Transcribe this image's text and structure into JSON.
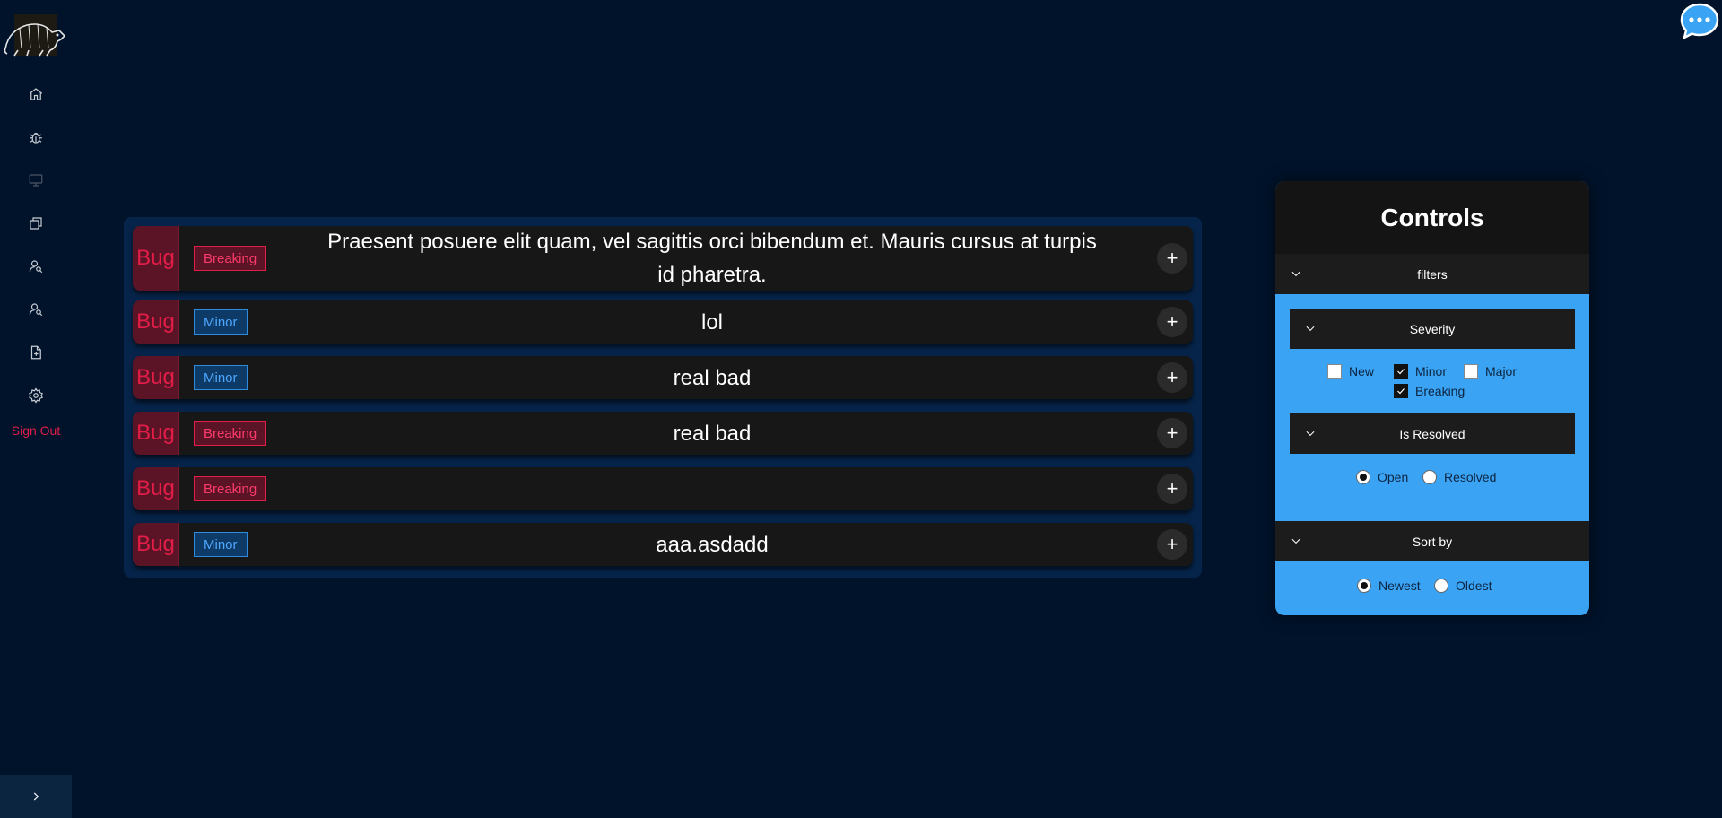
{
  "sidebar": {
    "nav": [
      {
        "icon": "home-icon"
      },
      {
        "icon": "bug-icon"
      },
      {
        "icon": "monitor-icon"
      },
      {
        "icon": "copy-icon"
      },
      {
        "icon": "user-search-icon"
      },
      {
        "icon": "user-search-icon"
      },
      {
        "icon": "file-plus-icon"
      },
      {
        "icon": "gear-icon"
      }
    ],
    "sign_out": "Sign Out",
    "expand_icon": "chevron-right-icon"
  },
  "chat_icon": "chat-bubble-icon",
  "bugs": [
    {
      "type": "Bug",
      "severity": "Breaking",
      "title": "Praesent posuere elit quam, vel sagittis orci bibendum et. Mauris cursus at turpis id pharetra."
    },
    {
      "type": "Bug",
      "severity": "Minor",
      "title": "lol"
    },
    {
      "type": "Bug",
      "severity": "Minor",
      "title": "real bad"
    },
    {
      "type": "Bug",
      "severity": "Breaking",
      "title": "real bad"
    },
    {
      "type": "Bug",
      "severity": "Breaking",
      "title": ""
    },
    {
      "type": "Bug",
      "severity": "Minor",
      "title": "aaa.asdadd"
    }
  ],
  "add_label": "+",
  "controls": {
    "title": "Controls",
    "filters_label": "filters",
    "severity": {
      "label": "Severity",
      "options": [
        {
          "label": "New",
          "checked": false
        },
        {
          "label": "Minor",
          "checked": true
        },
        {
          "label": "Major",
          "checked": false
        },
        {
          "label": "Breaking",
          "checked": true
        }
      ]
    },
    "resolved": {
      "label": "Is Resolved",
      "options": [
        {
          "label": "Open",
          "selected": true
        },
        {
          "label": "Resolved",
          "selected": false
        }
      ]
    },
    "sort": {
      "label": "Sort by",
      "options": [
        {
          "label": "Newest",
          "selected": true
        },
        {
          "label": "Oldest",
          "selected": false
        }
      ]
    }
  },
  "colors": {
    "background": "#00132b",
    "bug_red": "#e11d48",
    "minor_blue": "#2f8bdc",
    "controls_blue": "#3aa3f4"
  }
}
